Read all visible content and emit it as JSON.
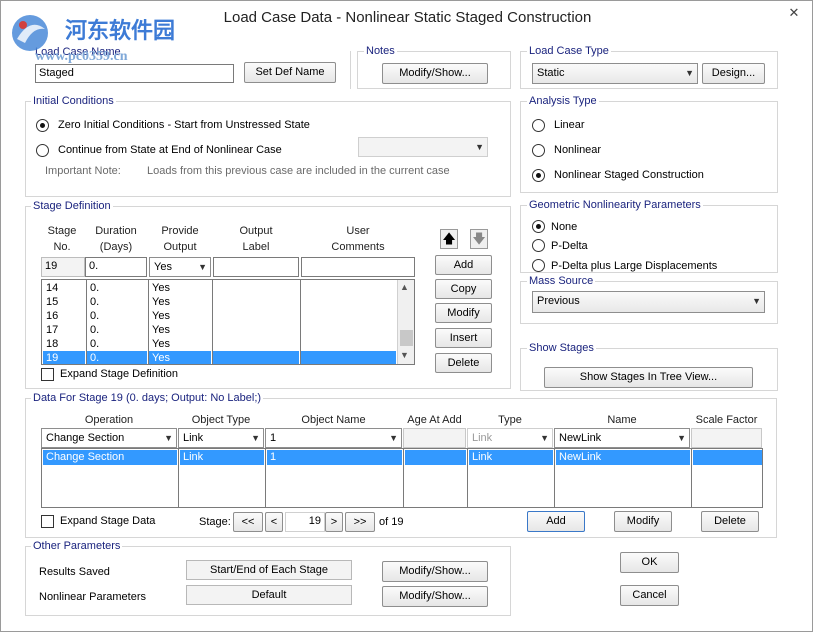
{
  "window": {
    "title": "Load Case Data - Nonlinear Static Staged Construction",
    "close": "✕"
  },
  "watermark": {
    "line1": "河东软件园",
    "line2": "www.pc0359.cn"
  },
  "load_case_name": {
    "label": "Load Case Name",
    "value": "Staged",
    "set_def_name": "Set Def Name"
  },
  "notes": {
    "label": "Notes",
    "button": "Modify/Show..."
  },
  "load_case_type": {
    "label": "Load Case Type",
    "value": "Static",
    "design": "Design..."
  },
  "initial_conditions": {
    "label": "Initial Conditions",
    "option1": "Zero Initial Conditions - Start from Unstressed State",
    "option2": "Continue from State at End of Nonlinear Case",
    "important_note_label": "Important Note:",
    "important_note_text": "Loads from this previous case are included in the current case"
  },
  "analysis_type": {
    "label": "Analysis Type",
    "options": [
      "Linear",
      "Nonlinear",
      "Nonlinear Staged Construction"
    ]
  },
  "stage_definition": {
    "label": "Stage Definition",
    "headers": {
      "stage1": "Stage",
      "stage2": "No.",
      "duration1": "Duration",
      "duration2": "(Days)",
      "provide1": "Provide",
      "provide2": "Output",
      "output1": "Output",
      "output2": "Label",
      "comments1": "User",
      "comments2": "Comments"
    },
    "edit_row": {
      "stage": "19",
      "duration": "0.",
      "provide": "Yes"
    },
    "rows": [
      {
        "stage": "14",
        "duration": "0.",
        "provide": "Yes"
      },
      {
        "stage": "15",
        "duration": "0.",
        "provide": "Yes"
      },
      {
        "stage": "16",
        "duration": "0.",
        "provide": "Yes"
      },
      {
        "stage": "17",
        "duration": "0.",
        "provide": "Yes"
      },
      {
        "stage": "18",
        "duration": "0.",
        "provide": "Yes"
      },
      {
        "stage": "19",
        "duration": "0.",
        "provide": "Yes"
      }
    ],
    "buttons": {
      "add": "Add",
      "copy": "Copy",
      "modify": "Modify",
      "insert": "Insert",
      "delete": "Delete"
    },
    "expand": "Expand Stage Definition"
  },
  "geometric": {
    "label": "Geometric Nonlinearity Parameters",
    "options": [
      "None",
      "P-Delta",
      "P-Delta plus Large Displacements"
    ]
  },
  "mass_source": {
    "label": "Mass Source",
    "value": "Previous"
  },
  "show_stages": {
    "label": "Show Stages",
    "button": "Show Stages In Tree View..."
  },
  "stage_data": {
    "label": "Data For Stage 19  (0. days;  Output: No Label;)",
    "headers": {
      "operation": "Operation",
      "object_type": "Object Type",
      "object_name": "Object Name",
      "age": "Age At Add",
      "type": "Type",
      "name": "Name",
      "scale": "Scale Factor"
    },
    "edit_row": {
      "operation": "Change Section",
      "object_type": "Link",
      "object_name": "1",
      "type": "Link",
      "name": "NewLink"
    },
    "row": {
      "operation": "Change Section",
      "object_type": "Link",
      "object_name": "1",
      "type": "Link",
      "name": "NewLink"
    },
    "expand": "Expand Stage Data",
    "stage_label": "Stage:",
    "first": "<<",
    "prev": "<",
    "current": "19",
    "next": ">",
    "last": ">>",
    "of": "of 19",
    "add": "Add",
    "modify": "Modify",
    "delete": "Delete"
  },
  "other": {
    "label": "Other Parameters",
    "results_saved_label": "Results Saved",
    "results_saved_value": "Start/End of Each Stage",
    "nonlinear_label": "Nonlinear Parameters",
    "nonlinear_value": "Default",
    "modify1": "Modify/Show...",
    "modify2": "Modify/Show..."
  },
  "ok": "OK",
  "cancel": "Cancel"
}
